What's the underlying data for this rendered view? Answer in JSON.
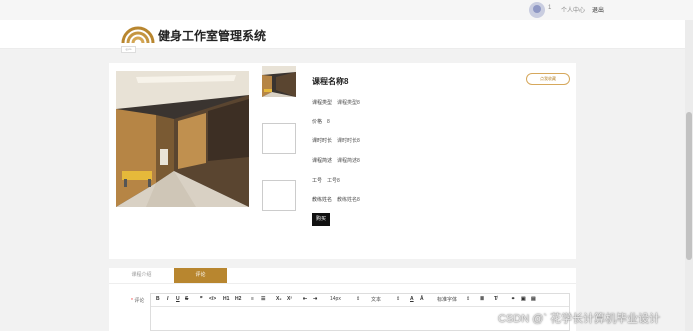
{
  "topbar": {
    "username": "1",
    "profile_link": "个人中心",
    "logout_link": "退出"
  },
  "header": {
    "title": "健身工作室管理系统",
    "logo_tab": "gym"
  },
  "course": {
    "title": "课程名称8",
    "collect_button": "点我收藏",
    "fields": [
      {
        "label": "课程类型",
        "value": "课程类型8"
      },
      {
        "label": "价格",
        "value": "8"
      },
      {
        "label": "课时时长",
        "value": "课时时长8"
      },
      {
        "label": "课程简述",
        "value": "课程简述8"
      },
      {
        "label": "工号",
        "value": "工号8"
      },
      {
        "label": "教练姓名",
        "value": "教练姓名8"
      }
    ],
    "buy_button": "购买"
  },
  "tabs": [
    {
      "label": "课程介绍"
    },
    {
      "label": "评论"
    }
  ],
  "comment": {
    "label": "评论"
  },
  "editor_toolbar": {
    "bold": "B",
    "italic": "I",
    "underline": "U",
    "strike": "S",
    "quote": "❞",
    "code": "</>",
    "h1": "H1",
    "h2": "H2",
    "ol": "≡",
    "ul": "☰",
    "sub": "X₂",
    "sup": "X²",
    "indent_less": "⇤",
    "indent_more": "⇥",
    "size": "14px",
    "size_caret": "⇕",
    "text_type": "文本",
    "text_caret": "⇕",
    "color": "A",
    "bg": "Ā",
    "font": "标准字体",
    "font_caret": "⇕",
    "align": "≣",
    "clear": "T̸",
    "link": "⚭",
    "image": "▣",
    "video": "▤"
  },
  "watermark": "CSDN @`  花学长计算机毕业设计",
  "colors": {
    "accent": "#b8862f",
    "buy": "#111111"
  }
}
